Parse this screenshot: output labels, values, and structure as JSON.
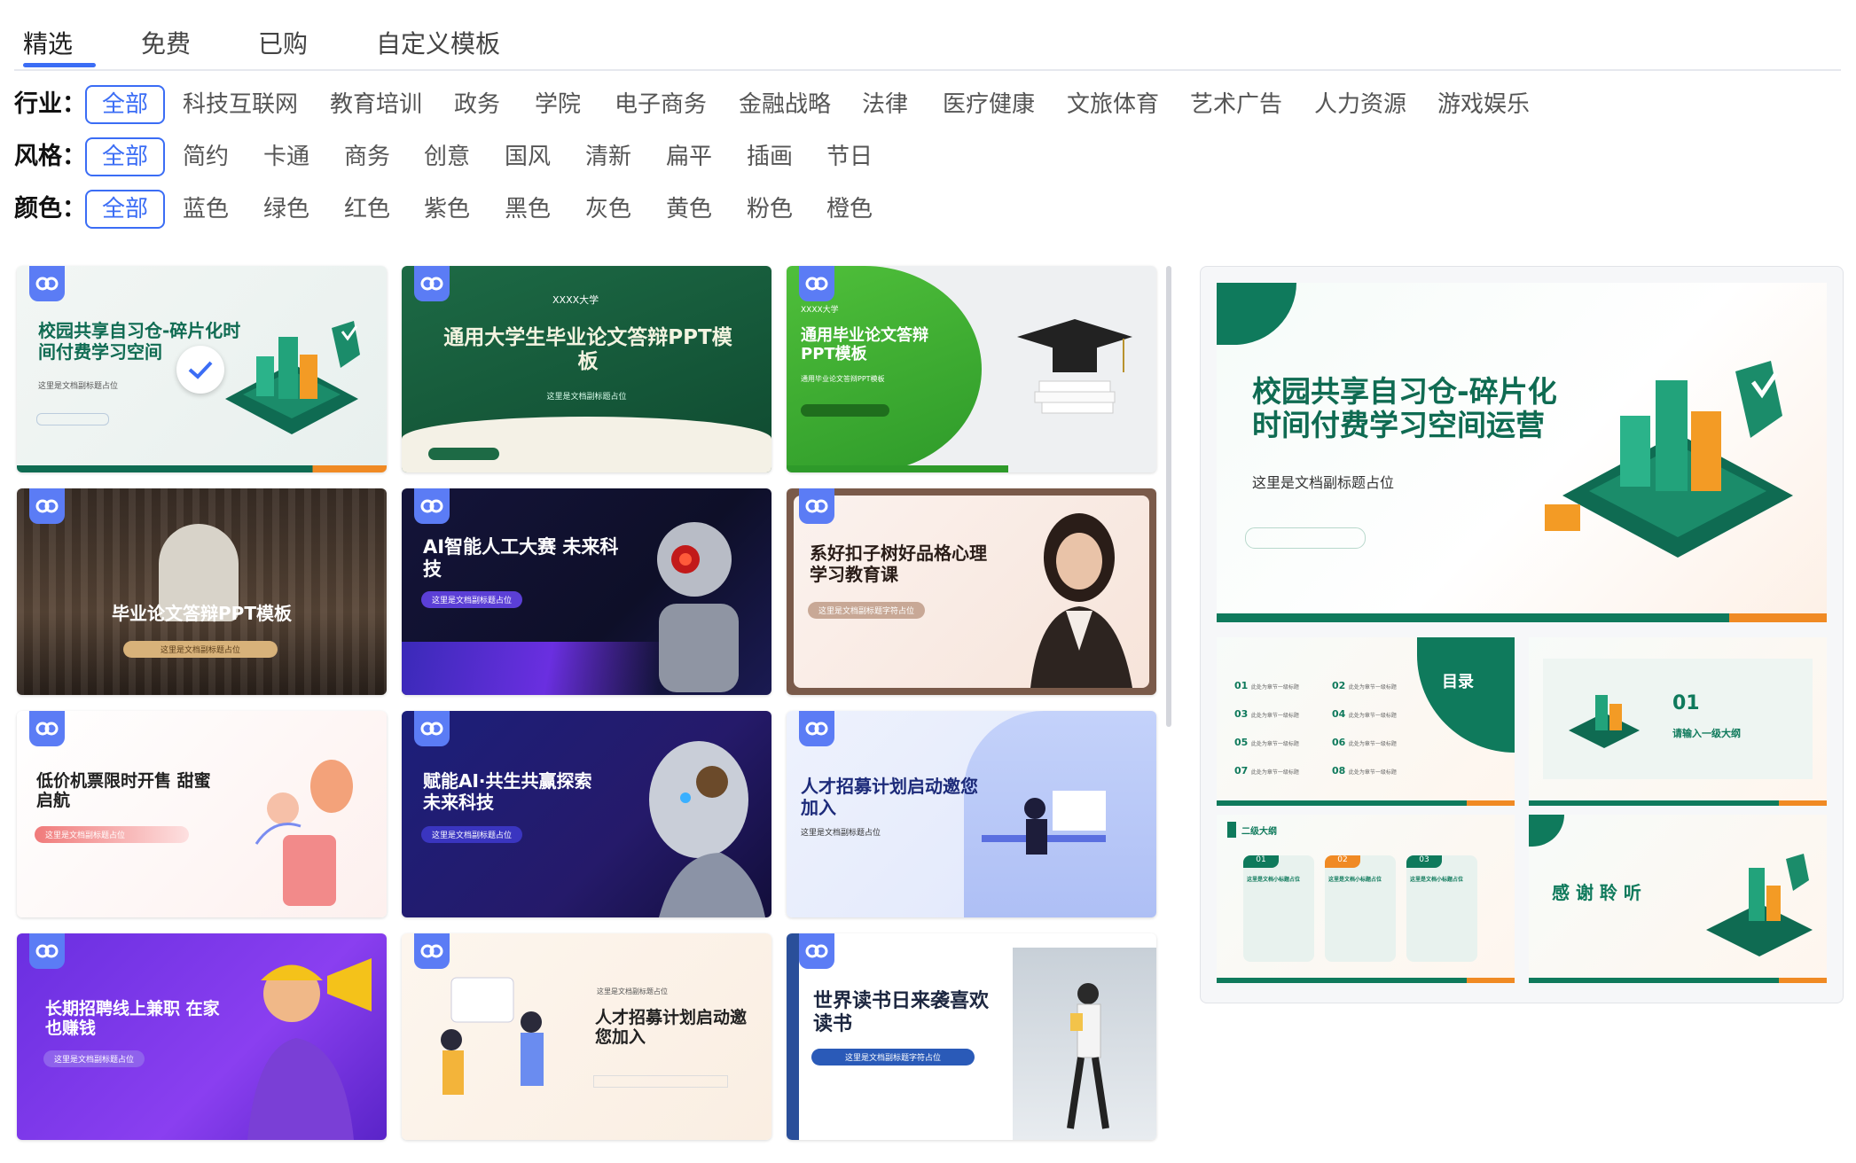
{
  "tabs": [
    "精选",
    "免费",
    "已购",
    "自定义模板"
  ],
  "filters": {
    "industry": {
      "label": "行业：",
      "options": [
        "全部",
        "科技互联网",
        "教育培训",
        "政务",
        "学院",
        "电子商务",
        "金融战略",
        "法律",
        "医疗健康",
        "文旅体育",
        "艺术广告",
        "人力资源",
        "游戏娱乐"
      ]
    },
    "style": {
      "label": "风格：",
      "options": [
        "全部",
        "简约",
        "卡通",
        "商务",
        "创意",
        "国风",
        "清新",
        "扁平",
        "插画",
        "节日"
      ]
    },
    "color": {
      "label": "颜色：",
      "options": [
        "全部",
        "蓝色",
        "绿色",
        "红色",
        "紫色",
        "黑色",
        "灰色",
        "黄色",
        "粉色",
        "橙色"
      ]
    }
  },
  "templates": [
    {
      "title": "校园共享自习仓-碎片化时间付费学习空间",
      "subtitle": "这里是文档副标题占位",
      "selected": true
    },
    {
      "title": "通用大学生毕业论文答辩PPT模板",
      "subtitle": "这里是文档副标题占位",
      "university": "XXXX大学"
    },
    {
      "title": "通用毕业论文答辩PPT模板",
      "subtitle": "通用毕业论文答辩PPT模板",
      "university": "XXXX大学"
    },
    {
      "title": "毕业论文答辩PPT模板",
      "subtitle": "这里是文档副标题占位"
    },
    {
      "title": "AI智能人工大赛 未来科技",
      "subtitle": "这里是文档副标题占位"
    },
    {
      "title": "系好扣子树好品格心理学习教育课",
      "subtitle": "这里是文档副标题字符占位"
    },
    {
      "title": "低价机票限时开售 甜蜜启航",
      "subtitle": "这里是文档副标题占位"
    },
    {
      "title": "赋能AI·共生共赢探索未来科技",
      "subtitle": "这里是文档副标题占位"
    },
    {
      "title": "人才招募计划启动邀您加入",
      "subtitle": "这里是文档副标题占位"
    },
    {
      "title": "长期招聘线上兼职 在家也赚钱",
      "subtitle": "这里是文档副标题占位"
    },
    {
      "title": "人才招募计划启动邀您加入",
      "subtitle": "这里是文档副标题占位"
    },
    {
      "title": "世界读书日来袭喜欢读书",
      "subtitle": "这里是文档副标题字符占位"
    }
  ],
  "preview": {
    "title_line1": "校园共享自习仓-碎片化",
    "title_line2": "时间付费学习空间运营",
    "subtitle": "这里是文档副标题占位",
    "toc_title": "目录",
    "toc_items": [
      "01",
      "02",
      "03",
      "04",
      "05",
      "06",
      "07",
      "08"
    ],
    "toc_item_text": "此处为章节一级标题",
    "section_number": "01",
    "section_text": "请输入一级大纲",
    "slide4_header": "二级大纲",
    "slide4_cards": [
      "01",
      "02",
      "03"
    ],
    "slide4_card_title": "这里是文档小标题占位",
    "thanks": "感 谢 聆 听"
  },
  "colors": {
    "accent": "#3b6df5",
    "green": "#0f7a5c",
    "orange": "#f08a24",
    "purple": "#6a2fe0",
    "navy": "#1d2b7a"
  }
}
